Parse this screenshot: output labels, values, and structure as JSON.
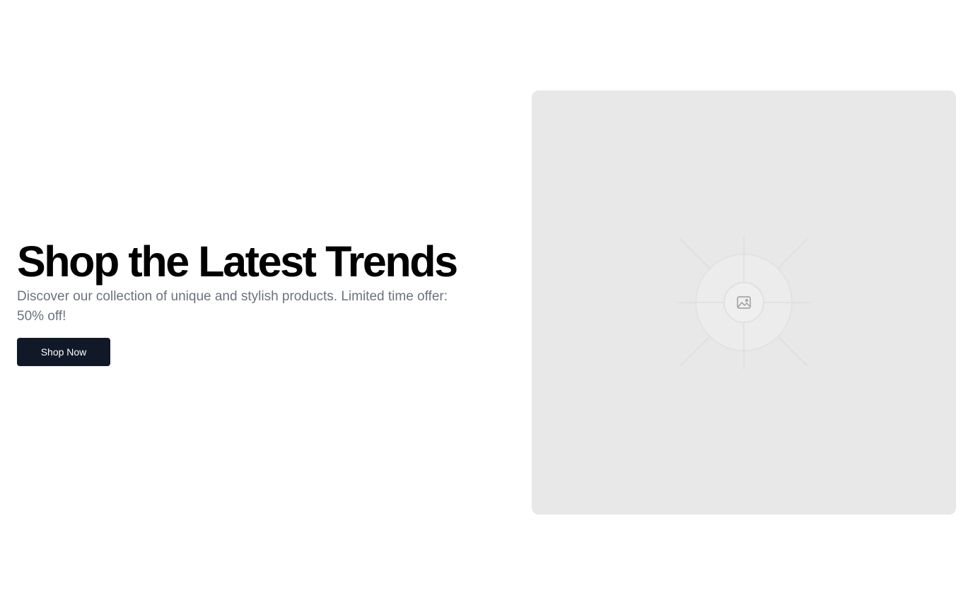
{
  "hero": {
    "title": "Shop the Latest Trends",
    "subtitle": "Discover our collection of unique and stylish products. Limited time offer: 50% off!",
    "cta_label": "Shop Now"
  },
  "media": {
    "icon": "image-icon"
  },
  "colors": {
    "title": "#000000",
    "subtitle": "#6b7280",
    "button_bg": "#111827",
    "button_text": "#ffffff",
    "placeholder_bg": "#e8e8e8"
  }
}
